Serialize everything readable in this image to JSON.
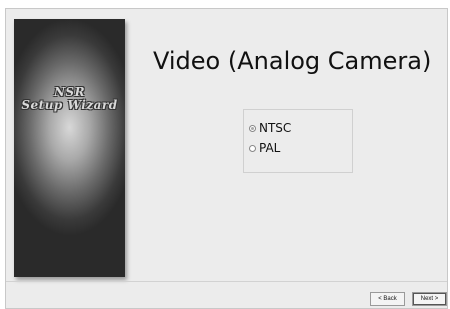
{
  "banner": {
    "line1": "NSR",
    "line2": "Setup Wizard"
  },
  "page": {
    "title": "Video (Analog Camera)"
  },
  "options": {
    "selected": "NTSC",
    "items": [
      {
        "label": "NTSC",
        "checked": true
      },
      {
        "label": "PAL",
        "checked": false
      }
    ]
  },
  "buttons": {
    "back": "< Back",
    "next": "Next >"
  }
}
